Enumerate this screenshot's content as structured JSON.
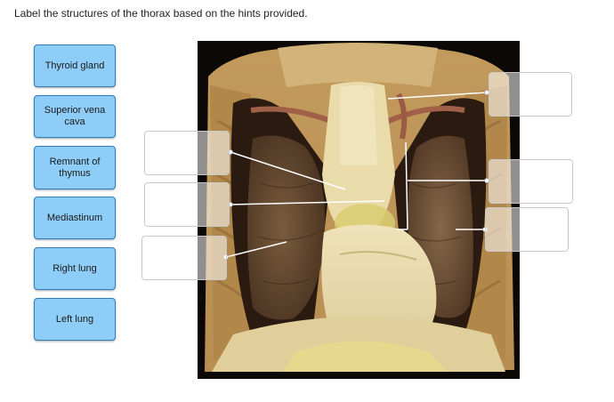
{
  "instruction": "Label the structures of the thorax based on the hints provided.",
  "labels": [
    {
      "text": "Thyroid gland"
    },
    {
      "text": "Superior vena cava"
    },
    {
      "text": "Remnant of thymus"
    },
    {
      "text": "Mediastinum"
    },
    {
      "text": "Right lung"
    },
    {
      "text": "Left lung"
    }
  ],
  "drop_targets": [
    {
      "id": "top-right",
      "value": ""
    },
    {
      "id": "left-upper",
      "value": ""
    },
    {
      "id": "left-middle",
      "value": ""
    },
    {
      "id": "left-lower",
      "value": ""
    },
    {
      "id": "right-middle",
      "value": ""
    },
    {
      "id": "right-lower",
      "value": ""
    }
  ],
  "colors": {
    "chip_fill": "#8ecdf7",
    "chip_border": "#2f7fc0",
    "leader_line": "#ffffff"
  }
}
